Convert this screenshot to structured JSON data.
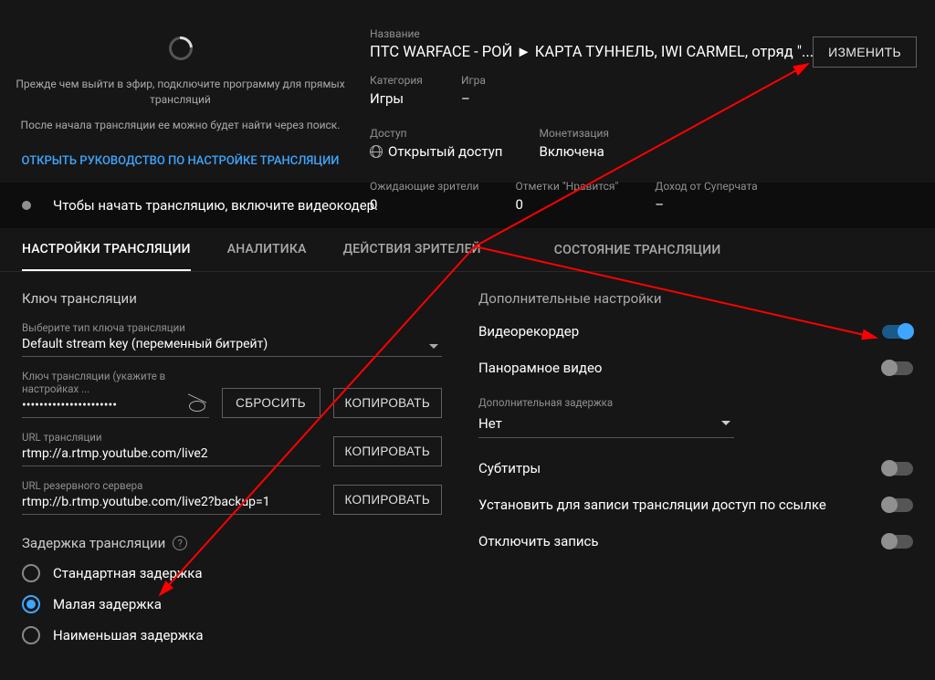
{
  "preview": {
    "line1": "Прежде чем выйти в эфир, подключите программу для прямых трансляций",
    "line2": "После начала трансляции ее можно будет найти через поиск.",
    "guide": "ОТКРЫТЬ РУКОВОДСТВО ПО НАСТРОЙКЕ ТРАНСЛЯЦИИ"
  },
  "info": {
    "title_label": "Название",
    "title_value": "ПТС WARFACE - РОЙ ► КАРТА ТУННЕЛЬ, IWI CARMEL, отряд \"...",
    "category_label": "Категория",
    "category_value": "Игры",
    "game_label": "Игра",
    "game_value": "–",
    "access_label": "Доступ",
    "access_value": "Открытый доступ",
    "monet_label": "Монетизация",
    "monet_value": "Включена",
    "waiting_label": "Ожидающие зрители",
    "waiting_value": "0",
    "likes_label": "Отметки \"Нравится\"",
    "likes_value": "0",
    "superchat_label": "Доход от Суперчата",
    "superchat_value": "–",
    "edit_btn": "ИЗМЕНИТЬ"
  },
  "status_message": "Чтобы начать трансляцию, включите видеокодер.",
  "tabs": {
    "settings": "НАСТРОЙКИ ТРАНСЛЯЦИИ",
    "analytics": "АНАЛИТИКА",
    "viewers": "ДЕЙСТВИЯ ЗРИТЕЛЕЙ",
    "health": "СОСТОЯНИЕ ТРАНСЛЯЦИИ"
  },
  "stream_key": {
    "section": "Ключ трансляции",
    "select_label": "Выберите тип ключа трансляции",
    "select_value": "Default stream key (переменный битрейт)",
    "key_label": "Ключ трансляции (укажите в настройках ...",
    "key_value": "••••••••••••••••••••••",
    "url_label": "URL трансляции",
    "url_value": "rtmp://a.rtmp.youtube.com/live2",
    "backup_label": "URL резервного сервера",
    "backup_value": "rtmp://b.rtmp.youtube.com/live2?backup=1",
    "reset_btn": "СБРОСИТЬ",
    "copy_btn": "КОПИРОВАТЬ"
  },
  "latency": {
    "title": "Задержка трансляции",
    "options": {
      "standard": "Стандартная задержка",
      "low": "Малая задержка",
      "ultralow": "Наименьшая задержка"
    }
  },
  "extra": {
    "title": "Дополнительные настройки",
    "dvr": "Видеорекордер",
    "vr": "Панорамное видео",
    "delay_label": "Дополнительная задержка",
    "delay_value": "Нет",
    "subtitles": "Субтитры",
    "unlisted_replay": "Установить для записи трансляции доступ по ссылке",
    "disable_record": "Отключить запись"
  }
}
